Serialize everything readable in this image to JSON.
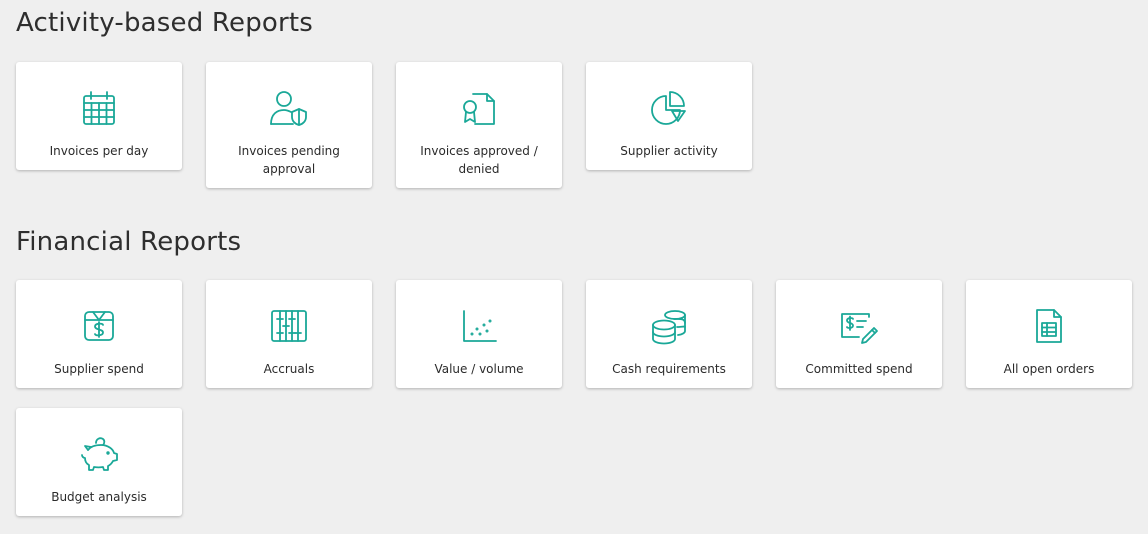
{
  "sections": {
    "activity": {
      "title": "Activity-based Reports",
      "cards": [
        {
          "label": "Invoices per day",
          "icon": "calendar-icon"
        },
        {
          "label": "Invoices pending approval",
          "icon": "user-shield-icon"
        },
        {
          "label": "Invoices approved / denied",
          "icon": "certificate-document-icon"
        },
        {
          "label": "Supplier activity",
          "icon": "pie-chart-icon"
        }
      ]
    },
    "financial": {
      "title": "Financial Reports",
      "cards": [
        {
          "label": "Supplier spend",
          "icon": "dollar-box-icon"
        },
        {
          "label": "Accruals",
          "icon": "abacus-icon"
        },
        {
          "label": "Value / volume",
          "icon": "scatter-plot-icon"
        },
        {
          "label": "Cash requirements",
          "icon": "coin-stack-icon"
        },
        {
          "label": "Committed spend",
          "icon": "cheque-pen-icon"
        },
        {
          "label": "All open orders",
          "icon": "spreadsheet-document-icon"
        },
        {
          "label": "Budget analysis",
          "icon": "piggy-bank-icon"
        }
      ]
    }
  },
  "colors": {
    "accent": "#1aa898",
    "background": "#efefef",
    "card": "#ffffff",
    "text": "#2b2b2b"
  }
}
